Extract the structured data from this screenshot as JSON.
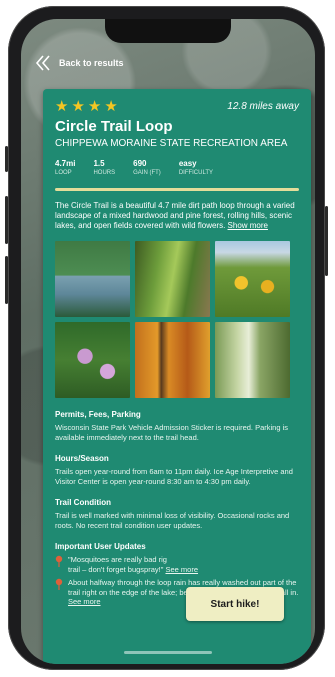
{
  "nav": {
    "back_label": "Back to results"
  },
  "trail": {
    "rating": 4,
    "distance": "12.8 miles away",
    "title": "Circle Trail Loop",
    "area": "CHIPPEWA MORAINE STATE RECREATION AREA",
    "stats": [
      {
        "value": "4.7mi",
        "label": "LOOP"
      },
      {
        "value": "1.5",
        "label": "HOURS"
      },
      {
        "value": "690",
        "label": "GAIN (FT)"
      },
      {
        "value": "easy",
        "label": "DIFFICULTY"
      }
    ],
    "description": {
      "name": "The Circle Trail",
      "text": " is a beautiful 4.7 mile dirt path loop through a varied landscape of a mixed hardwood and pine forest, rolling hills, scenic lakes, and open fields covered with wild flowers. ",
      "show_more": "Show more"
    }
  },
  "photos": [
    "lake-forest-photo",
    "fern-forest-photo",
    "wildflower-field-photo",
    "purple-flowers-photo",
    "autumn-forest-photo",
    "birch-trees-photo"
  ],
  "sections": {
    "permits": {
      "title": "Permits, Fees, Parking",
      "body": "Wisconsin State Park Vehicle Admission Sticker is required. Parking is available immediately next to the trail head."
    },
    "hours": {
      "title": "Hours/Season",
      "body": "Trails open year-round from 6am to 11pm daily. Ice Age Interpretive and Visitor Center is open year-round 8:30 am to 4:30 pm daily."
    },
    "condition": {
      "title": "Trail Condition",
      "body": "Trail is well marked with minimal loss of visibility. Occasional rocks and roots. No recent trail condition user updates."
    },
    "updates": {
      "title": "Important User Updates",
      "items": [
        {
          "text": "\"Mosquitoes are really bad rig",
          "text2": "trail – don't forget bugspray!\" ",
          "see_more": "See more"
        },
        {
          "text": "About halfway through the loop rain has really washed out part of the trail right on the edge of the lake; be careful if you don't want to fall in. ",
          "see_more": "See more"
        }
      ]
    }
  },
  "action": {
    "start_label": "Start hike!"
  },
  "colors": {
    "card": "#1f8a72",
    "star": "#f3c623",
    "button": "#efeec3",
    "divider": "#e4dd9a",
    "pin": "#e0603a"
  }
}
